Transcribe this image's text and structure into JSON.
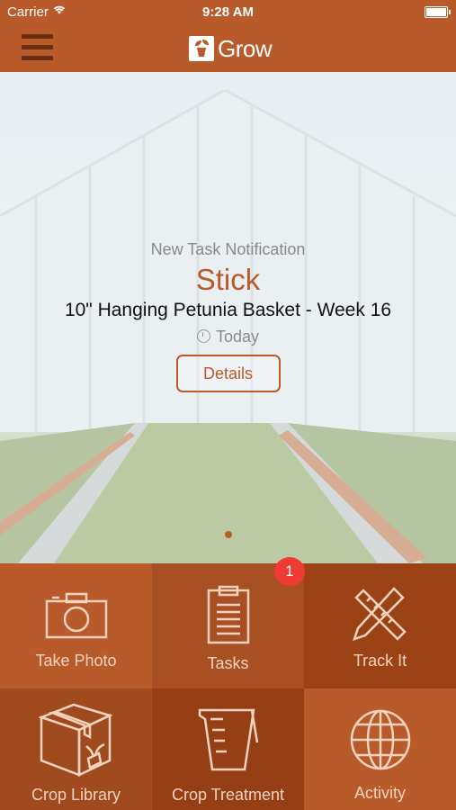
{
  "status_bar": {
    "carrier": "Carrier",
    "time": "9:28 AM"
  },
  "nav": {
    "app_name": "Grow"
  },
  "notification": {
    "heading": "New Task Notification",
    "task": "Stick",
    "crop": "10\" Hanging Petunia Basket - Week 16",
    "when": "Today",
    "details_label": "Details"
  },
  "pager": {
    "current": 1,
    "total": 1
  },
  "tiles": [
    {
      "label": "Take Photo",
      "icon": "camera-icon",
      "color": "#b95a2b"
    },
    {
      "label": "Tasks",
      "icon": "clipboard-icon",
      "color": "#a84f24",
      "badge": "1"
    },
    {
      "label": "Track It",
      "icon": "pencil-ruler-icon",
      "color": "#9c4217"
    },
    {
      "label": "Crop Library",
      "icon": "box-plant-icon",
      "color": "#a04a1f"
    },
    {
      "label": "Crop Treatment",
      "icon": "beaker-icon",
      "color": "#963f16"
    },
    {
      "label": "Activity",
      "icon": "globe-icon",
      "color": "#b95a2b"
    }
  ],
  "colors": {
    "brand": "#b95a2b",
    "badge": "#f03a35"
  }
}
